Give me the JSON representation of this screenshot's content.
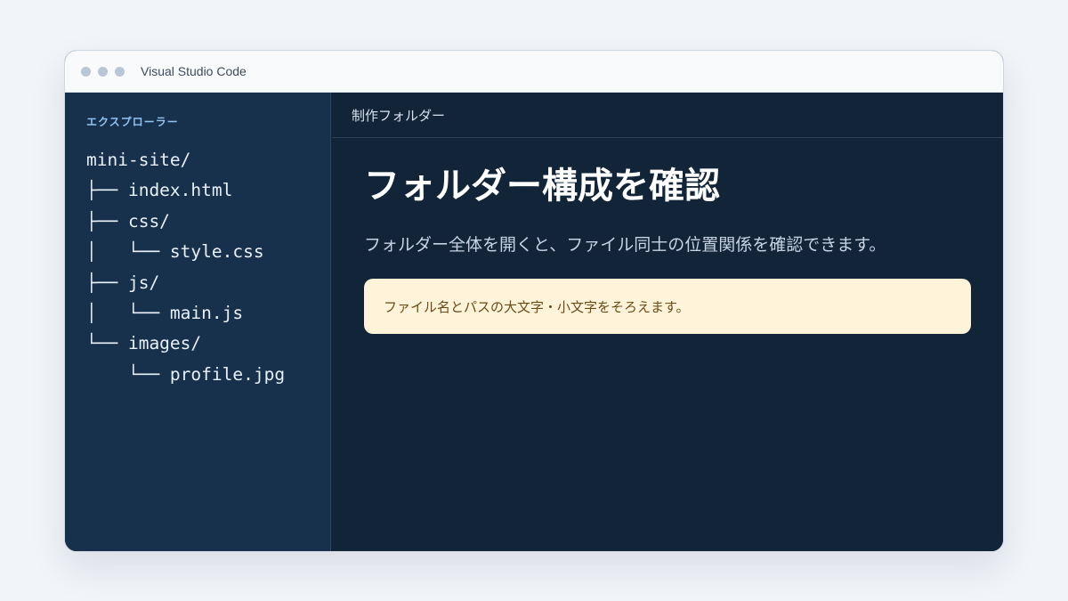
{
  "window": {
    "title": "Visual Studio Code"
  },
  "sidebar": {
    "title": "エクスプローラー",
    "tree": [
      "mini-site/",
      "├── index.html",
      "├── css/",
      "│   └── style.css",
      "├── js/",
      "│   └── main.js",
      "└── images/",
      "    └── profile.jpg"
    ]
  },
  "tab": {
    "label": "制作フォルダー"
  },
  "main": {
    "heading": "フォルダー構成を確認",
    "description": "フォルダー全体を開くと、ファイル同士の位置関係を確認できます。",
    "note": "ファイル名とパスの大文字・小文字をそろえます。"
  },
  "colors": {
    "background": "#f1f4f8",
    "sidebar": "#17304b",
    "editor": "#112438",
    "accent_blue": "#8fc3f2",
    "note_background": "#fff3d9",
    "note_text": "#6a4a16"
  }
}
